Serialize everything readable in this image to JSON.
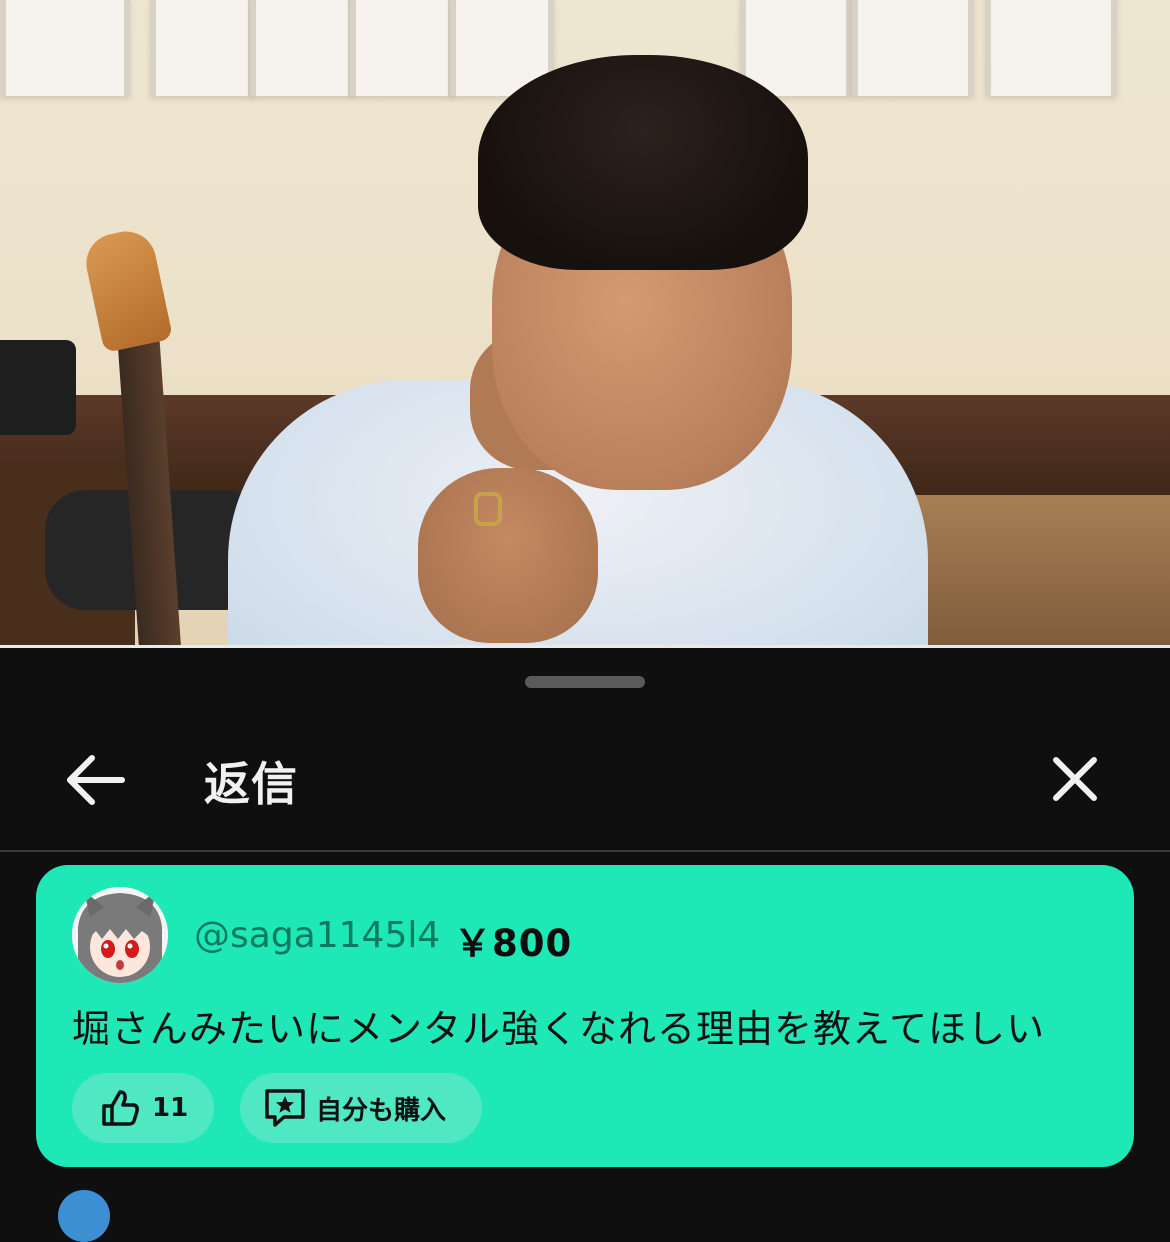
{
  "header": {
    "title": "返信"
  },
  "comment": {
    "handle": "@saga1145l4",
    "amount": "￥800",
    "text": "堀さんみたいにメンタル強くなれる理由を教えてほしい",
    "likes": "11",
    "buy_label": "自分も購入"
  },
  "colors": {
    "card_background": "#1ee9b6",
    "panel_background": "#0f0f0f"
  },
  "icons": [
    "arrow-left-icon",
    "close-icon",
    "thumb-up-icon",
    "star-chat-icon"
  ]
}
